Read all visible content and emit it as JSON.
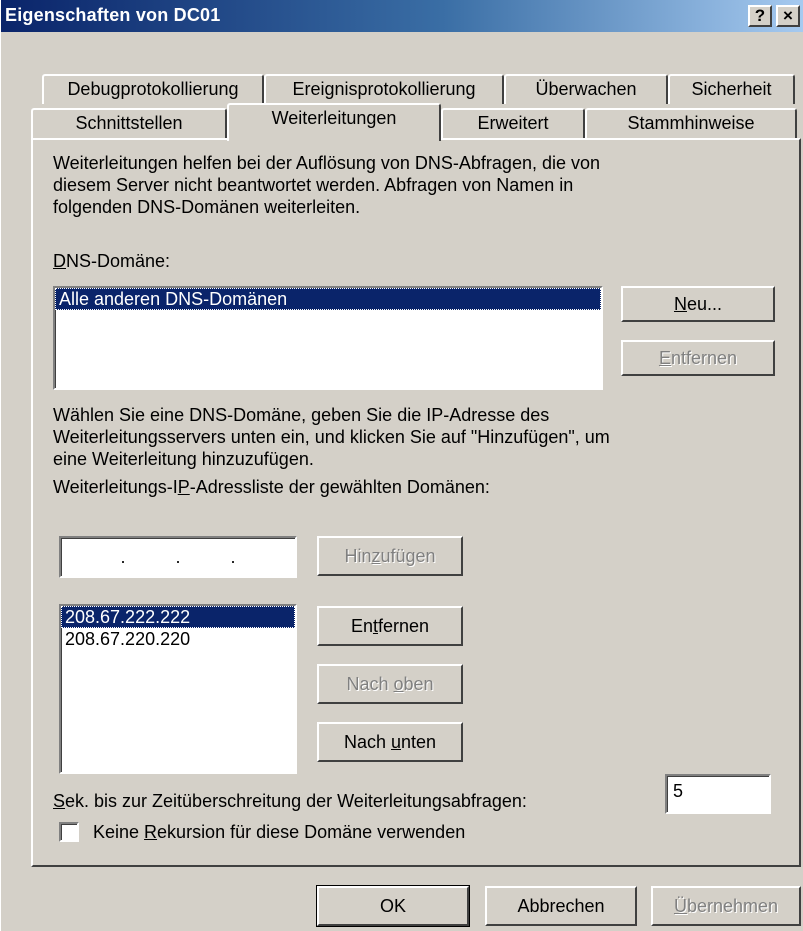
{
  "window": {
    "title": "Eigenschaften von DC01",
    "help_label": "?",
    "close_label": "×"
  },
  "tabs_row1": [
    "Debugprotokollierung",
    "Ereignisprotokollierung",
    "Überwachen",
    "Sicherheit"
  ],
  "tabs_row2": [
    "Schnittstellen",
    "Weiterleitungen",
    "Erweitert",
    "Stammhinweise"
  ],
  "active_tab": "Weiterleitungen",
  "intro": [
    "Weiterleitungen helfen bei der Auflösung von DNS-Abfragen, die von",
    "diesem Server nicht beantwortet werden. Abfragen von Namen in",
    "folgenden DNS-Domänen weiterleiten."
  ],
  "dns_domain": {
    "label_first": "D",
    "label_rest": "NS-Domäne:",
    "items": [
      "Alle anderen DNS-Domänen"
    ],
    "selected_index": 0,
    "new_button": {
      "u": "N",
      "rest": "eu..."
    },
    "remove_button": {
      "u": "E",
      "rest": "ntfernen"
    }
  },
  "help_text": [
    "Wählen Sie eine DNS-Domäne, geben Sie die IP-Adresse des",
    "Weiterleitungsservers unten ein, und klicken Sie auf \"Hinzufügen\", um",
    "eine Weiterleitung hinzuzufügen."
  ],
  "ip_list": {
    "label_pre": "Weiterleitungs-I",
    "label_u": "P",
    "label_post": "-Adressliste der gewählten Domänen:",
    "ip_input_dots": ".          .          .",
    "add_button": {
      "pre": "Hin",
      "u": "z",
      "post": "ufügen"
    },
    "items": [
      "208.67.222.222",
      "208.67.220.220"
    ],
    "selected_index": 0,
    "remove_button": {
      "pre": "En",
      "u": "t",
      "post": "fernen"
    },
    "up_button": {
      "pre": "Nach ",
      "u": "o",
      "post": "ben"
    },
    "down_button": {
      "pre": "Nach ",
      "u": "u",
      "post": "nten"
    }
  },
  "timeout": {
    "label_u": "S",
    "label_rest": "ek. bis zur Zeitüberschreitung der Weiterleitungsabfragen:",
    "value": "5"
  },
  "no_recursion": {
    "label_pre": "Keine ",
    "label_u": "R",
    "label_post": "ekursion für diese Domäne verwenden",
    "checked": false
  },
  "footer": {
    "ok": "OK",
    "cancel": "Abbrechen",
    "apply_u": "Ü",
    "apply_rest": "bernehmen"
  }
}
